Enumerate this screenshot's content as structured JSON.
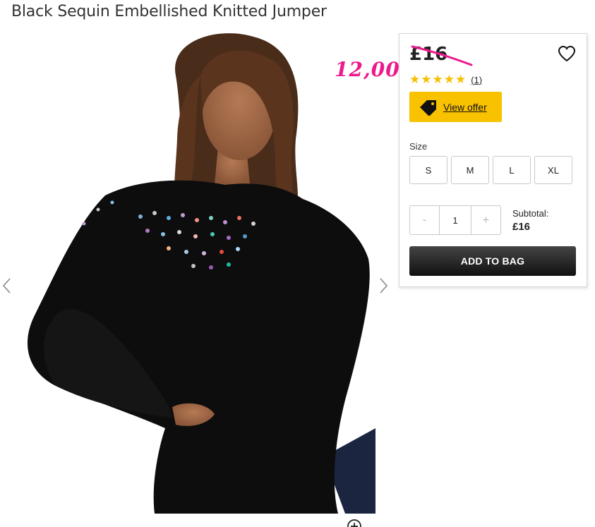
{
  "product": {
    "title": "Black Sequin Embellished Knitted Jumper"
  },
  "gallery": {
    "prev_icon": "chevron-left-icon",
    "next_icon": "chevron-right-icon",
    "zoom_icon": "zoom-icon"
  },
  "panel": {
    "price": "£16",
    "sale_price": "12,00",
    "rating": {
      "stars": "★★★★★",
      "score": 5,
      "count": "(1)"
    },
    "offer_label": "View offer",
    "size_label": "Size",
    "sizes": [
      "S",
      "M",
      "L",
      "XL"
    ],
    "quantity": {
      "minus": "-",
      "value": "1",
      "plus": "+"
    },
    "subtotal_label": "Subtotal:",
    "subtotal_value": "£16",
    "add_to_bag": "ADD TO BAG"
  },
  "colors": {
    "offer_yellow": "#f9c200",
    "star_yellow": "#f5c000",
    "annotation_pink": "#ec1a8c",
    "button_dark": "#222222"
  }
}
